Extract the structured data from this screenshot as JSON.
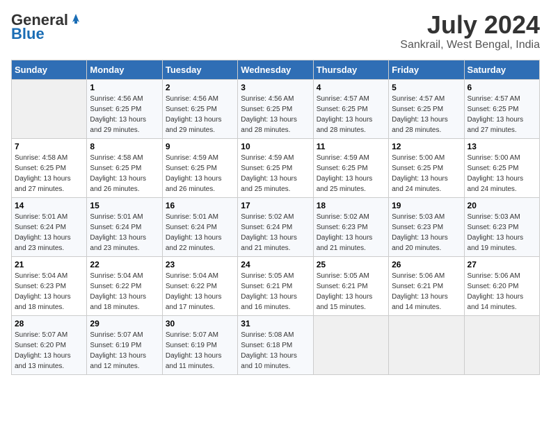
{
  "header": {
    "logo_general": "General",
    "logo_blue": "Blue",
    "month_year": "July 2024",
    "location": "Sankrail, West Bengal, India"
  },
  "columns": [
    "Sunday",
    "Monday",
    "Tuesday",
    "Wednesday",
    "Thursday",
    "Friday",
    "Saturday"
  ],
  "weeks": [
    [
      {
        "num": "",
        "info": ""
      },
      {
        "num": "1",
        "info": "Sunrise: 4:56 AM\nSunset: 6:25 PM\nDaylight: 13 hours\nand 29 minutes."
      },
      {
        "num": "2",
        "info": "Sunrise: 4:56 AM\nSunset: 6:25 PM\nDaylight: 13 hours\nand 29 minutes."
      },
      {
        "num": "3",
        "info": "Sunrise: 4:56 AM\nSunset: 6:25 PM\nDaylight: 13 hours\nand 28 minutes."
      },
      {
        "num": "4",
        "info": "Sunrise: 4:57 AM\nSunset: 6:25 PM\nDaylight: 13 hours\nand 28 minutes."
      },
      {
        "num": "5",
        "info": "Sunrise: 4:57 AM\nSunset: 6:25 PM\nDaylight: 13 hours\nand 28 minutes."
      },
      {
        "num": "6",
        "info": "Sunrise: 4:57 AM\nSunset: 6:25 PM\nDaylight: 13 hours\nand 27 minutes."
      }
    ],
    [
      {
        "num": "7",
        "info": "Sunrise: 4:58 AM\nSunset: 6:25 PM\nDaylight: 13 hours\nand 27 minutes."
      },
      {
        "num": "8",
        "info": "Sunrise: 4:58 AM\nSunset: 6:25 PM\nDaylight: 13 hours\nand 26 minutes."
      },
      {
        "num": "9",
        "info": "Sunrise: 4:59 AM\nSunset: 6:25 PM\nDaylight: 13 hours\nand 26 minutes."
      },
      {
        "num": "10",
        "info": "Sunrise: 4:59 AM\nSunset: 6:25 PM\nDaylight: 13 hours\nand 25 minutes."
      },
      {
        "num": "11",
        "info": "Sunrise: 4:59 AM\nSunset: 6:25 PM\nDaylight: 13 hours\nand 25 minutes."
      },
      {
        "num": "12",
        "info": "Sunrise: 5:00 AM\nSunset: 6:25 PM\nDaylight: 13 hours\nand 24 minutes."
      },
      {
        "num": "13",
        "info": "Sunrise: 5:00 AM\nSunset: 6:25 PM\nDaylight: 13 hours\nand 24 minutes."
      }
    ],
    [
      {
        "num": "14",
        "info": "Sunrise: 5:01 AM\nSunset: 6:24 PM\nDaylight: 13 hours\nand 23 minutes."
      },
      {
        "num": "15",
        "info": "Sunrise: 5:01 AM\nSunset: 6:24 PM\nDaylight: 13 hours\nand 23 minutes."
      },
      {
        "num": "16",
        "info": "Sunrise: 5:01 AM\nSunset: 6:24 PM\nDaylight: 13 hours\nand 22 minutes."
      },
      {
        "num": "17",
        "info": "Sunrise: 5:02 AM\nSunset: 6:24 PM\nDaylight: 13 hours\nand 21 minutes."
      },
      {
        "num": "18",
        "info": "Sunrise: 5:02 AM\nSunset: 6:23 PM\nDaylight: 13 hours\nand 21 minutes."
      },
      {
        "num": "19",
        "info": "Sunrise: 5:03 AM\nSunset: 6:23 PM\nDaylight: 13 hours\nand 20 minutes."
      },
      {
        "num": "20",
        "info": "Sunrise: 5:03 AM\nSunset: 6:23 PM\nDaylight: 13 hours\nand 19 minutes."
      }
    ],
    [
      {
        "num": "21",
        "info": "Sunrise: 5:04 AM\nSunset: 6:23 PM\nDaylight: 13 hours\nand 18 minutes."
      },
      {
        "num": "22",
        "info": "Sunrise: 5:04 AM\nSunset: 6:22 PM\nDaylight: 13 hours\nand 18 minutes."
      },
      {
        "num": "23",
        "info": "Sunrise: 5:04 AM\nSunset: 6:22 PM\nDaylight: 13 hours\nand 17 minutes."
      },
      {
        "num": "24",
        "info": "Sunrise: 5:05 AM\nSunset: 6:21 PM\nDaylight: 13 hours\nand 16 minutes."
      },
      {
        "num": "25",
        "info": "Sunrise: 5:05 AM\nSunset: 6:21 PM\nDaylight: 13 hours\nand 15 minutes."
      },
      {
        "num": "26",
        "info": "Sunrise: 5:06 AM\nSunset: 6:21 PM\nDaylight: 13 hours\nand 14 minutes."
      },
      {
        "num": "27",
        "info": "Sunrise: 5:06 AM\nSunset: 6:20 PM\nDaylight: 13 hours\nand 14 minutes."
      }
    ],
    [
      {
        "num": "28",
        "info": "Sunrise: 5:07 AM\nSunset: 6:20 PM\nDaylight: 13 hours\nand 13 minutes."
      },
      {
        "num": "29",
        "info": "Sunrise: 5:07 AM\nSunset: 6:19 PM\nDaylight: 13 hours\nand 12 minutes."
      },
      {
        "num": "30",
        "info": "Sunrise: 5:07 AM\nSunset: 6:19 PM\nDaylight: 13 hours\nand 11 minutes."
      },
      {
        "num": "31",
        "info": "Sunrise: 5:08 AM\nSunset: 6:18 PM\nDaylight: 13 hours\nand 10 minutes."
      },
      {
        "num": "",
        "info": ""
      },
      {
        "num": "",
        "info": ""
      },
      {
        "num": "",
        "info": ""
      }
    ]
  ]
}
